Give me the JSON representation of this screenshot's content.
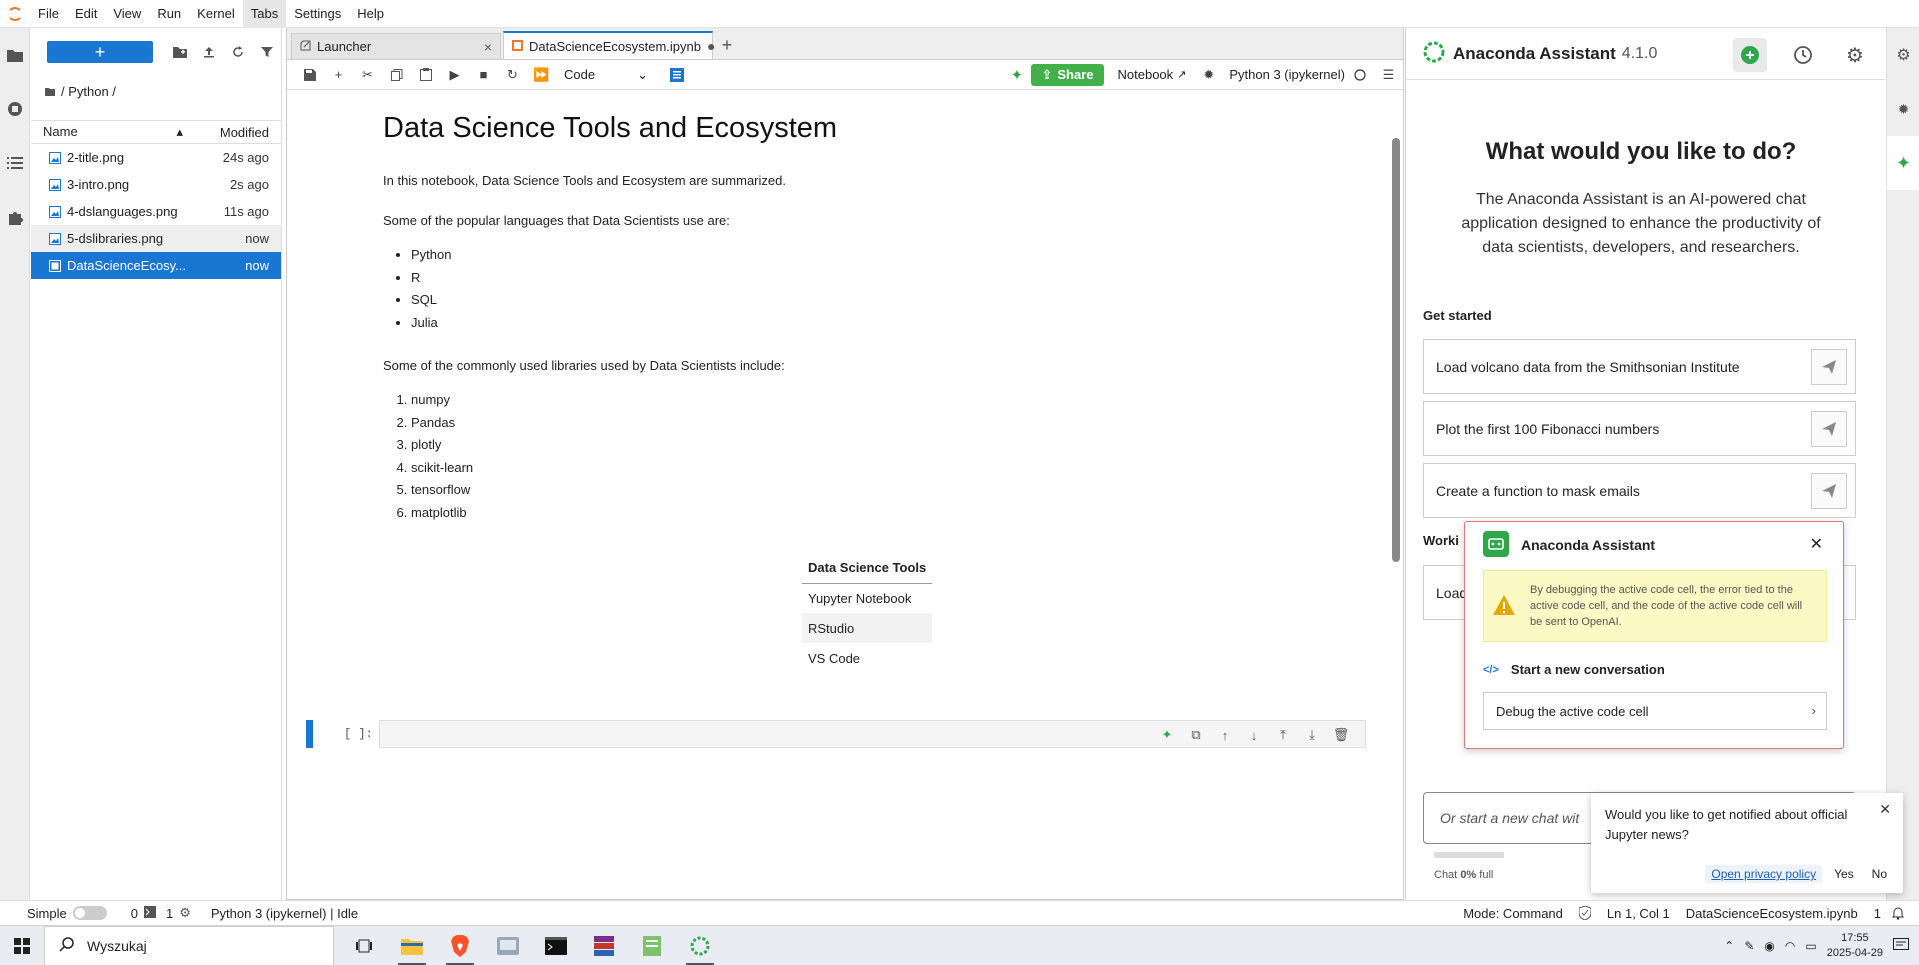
{
  "menubar": {
    "items": [
      "File",
      "Edit",
      "View",
      "Run",
      "Kernel",
      "Tabs",
      "Settings",
      "Help"
    ]
  },
  "filebrowser": {
    "breadcrumb": "/ Python /",
    "col_name": "Name",
    "col_modified": "Modified",
    "files": [
      {
        "name": "2-title.png",
        "modified": "24s ago"
      },
      {
        "name": "3-intro.png",
        "modified": "2s ago"
      },
      {
        "name": "4-dslanguages.png",
        "modified": "11s ago"
      },
      {
        "name": "5-dslibraries.png",
        "modified": "now"
      },
      {
        "name": "DataScienceEcosy...",
        "modified": "now"
      }
    ]
  },
  "tabs": {
    "launcher": "Launcher",
    "notebook": "DataScienceEcosystem.ipynb"
  },
  "toolbar": {
    "cell_type": "Code",
    "share": "Share",
    "notebook": "Notebook",
    "kernel": "Python 3 (ipykernel)"
  },
  "notebook": {
    "title": "Data Science Tools and Ecosystem",
    "intro": "In this notebook, Data Science Tools and Ecosystem are summarized.",
    "languages_intro": "Some of the popular languages that Data Scientists use are:",
    "languages": [
      "Python",
      "R",
      "SQL",
      "Julia"
    ],
    "libraries_intro": "Some of the commonly used libraries used by Data Scientists include:",
    "libraries": [
      "numpy",
      "Pandas",
      "plotly",
      "scikit-learn",
      "tensorflow",
      "matplotlib"
    ],
    "table_header": "Data Science Tools",
    "table_rows": [
      "Yupyter Notebook",
      "RStudio",
      "VS Code"
    ],
    "prompt": "[ ]:"
  },
  "assistant": {
    "title": "Anaconda Assistant",
    "version": "4.1.0",
    "heading": "What would you like to do?",
    "description": "The Anaconda Assistant is an AI-powered chat application designed to enhance the productivity of data scientists, developers, and researchers.",
    "get_started": "Get started",
    "suggestions": [
      "Load volcano data from the Smithsonian Institute",
      "Plot the first 100 Fibonacci numbers",
      "Create a function to mask emails"
    ],
    "working_label": "Worki",
    "working_item": "Load",
    "input_placeholder": "Or start a new chat wit",
    "usage_label": "Chat",
    "usage_value": "0%",
    "usage_suffix": "full"
  },
  "popup": {
    "title": "Anaconda Assistant",
    "warning": "By debugging the active code cell, the error tied to the active code cell, and the code of the active code cell will be sent to OpenAI.",
    "subheading": "Start a new conversation",
    "action": "Debug the active code cell"
  },
  "notification": {
    "text": "Would you like to get notified about official Jupyter news?",
    "link": "Open privacy policy",
    "yes": "Yes",
    "no": "No"
  },
  "statusbar": {
    "mode_label": "Simple",
    "terminals": "0",
    "kernels": "1",
    "kernel_status": "Python 3 (ipykernel) | Idle",
    "mode": "Mode: Command",
    "position": "Ln 1, Col 1",
    "file": "DataScienceEcosystem.ipynb",
    "count": "1"
  },
  "taskbar": {
    "search": "Wyszukaj",
    "time": "17:55",
    "date": "2025-04-29"
  },
  "colors": {
    "accent": "#1976d2",
    "share": "#43b04a",
    "assistant_green": "#2ea84a"
  }
}
